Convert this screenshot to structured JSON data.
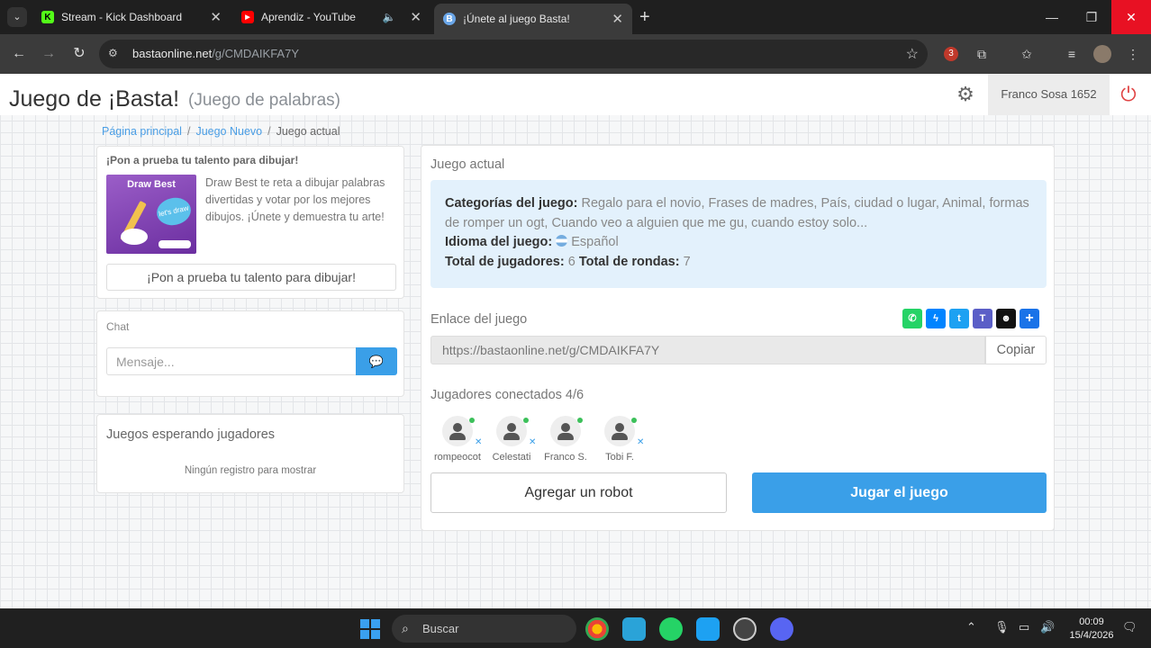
{
  "browser": {
    "tabs": [
      {
        "title": "Stream - Kick Dashboard",
        "favicon": "kick-icon",
        "color": "#53fc18"
      },
      {
        "title": "Aprendiz - YouTube",
        "favicon": "youtube-icon",
        "color": "#ff0000"
      },
      {
        "title": "¡Únete al juego Basta!",
        "favicon": "basta-icon",
        "color": "#6aa6e8"
      }
    ],
    "address": {
      "host": "bastaonline.net",
      "path": "/g/CMDAIKFA7Y"
    },
    "extension_badge": "3"
  },
  "header": {
    "title": "Juego de ¡Basta!",
    "subtitle": "(Juego de palabras)",
    "user": "Franco Sosa 1652"
  },
  "breadcrumb": {
    "home": "Página principal",
    "new_game": "Juego Nuevo",
    "current": "Juego actual"
  },
  "promo": {
    "title": "¡Pon a prueba tu talento para dibujar!",
    "image_title": "Draw Best",
    "image_bubble": "let's draw",
    "text": "Draw Best te reta a dibujar palabras divertidas y votar por los mejores dibujos. ¡Únete y demuestra tu arte!",
    "button": "¡Pon a prueba tu talento para dibujar!"
  },
  "chat": {
    "label": "Chat",
    "placeholder": "Mensaje..."
  },
  "waiting": {
    "title": "Juegos esperando jugadores",
    "empty": "Ningún registro para mostrar"
  },
  "game": {
    "label": "Juego actual",
    "categories_label": "Categorías del juego:",
    "categories": "Regalo para el novio, Frases de madres, País, ciudad o lugar, Animal, formas de romper un ogt, Cuando veo a alguien que me gu, cuando estoy solo...",
    "language_label": "Idioma del juego:",
    "language": "Español",
    "players_label": "Total de jugadores:",
    "players_total": "6",
    "rounds_label": "Total de rondas:",
    "rounds_total": "7",
    "link_label": "Enlace del juego",
    "link": "https://bastaonline.net/g/CMDAIKFA7Y",
    "copy": "Copiar",
    "connected_label": "Jugadores conectados 4/6",
    "players": [
      {
        "name": "rompeocot",
        "removable": true
      },
      {
        "name": "Celestati",
        "removable": true
      },
      {
        "name": "Franco S.",
        "removable": false
      },
      {
        "name": "Tobi F.",
        "removable": true
      }
    ],
    "add_robot": "Agregar un robot",
    "play": "Jugar el juego",
    "share": [
      {
        "name": "whatsapp-icon",
        "color": "#25d366"
      },
      {
        "name": "messenger-icon",
        "color": "#0084ff"
      },
      {
        "name": "twitter-icon",
        "color": "#1da1f2"
      },
      {
        "name": "teams-icon",
        "color": "#5b5fc7"
      },
      {
        "name": "snapchat-icon",
        "color": "#111111"
      },
      {
        "name": "add-share-icon",
        "color": "#1a73e8"
      }
    ]
  },
  "taskbar": {
    "search": "Buscar",
    "time": "00:09",
    "date": "15/4/2026"
  },
  "colors": {
    "accent": "#3a9fe8",
    "info_bg": "#e3f1fc",
    "online": "#3cc05a"
  }
}
